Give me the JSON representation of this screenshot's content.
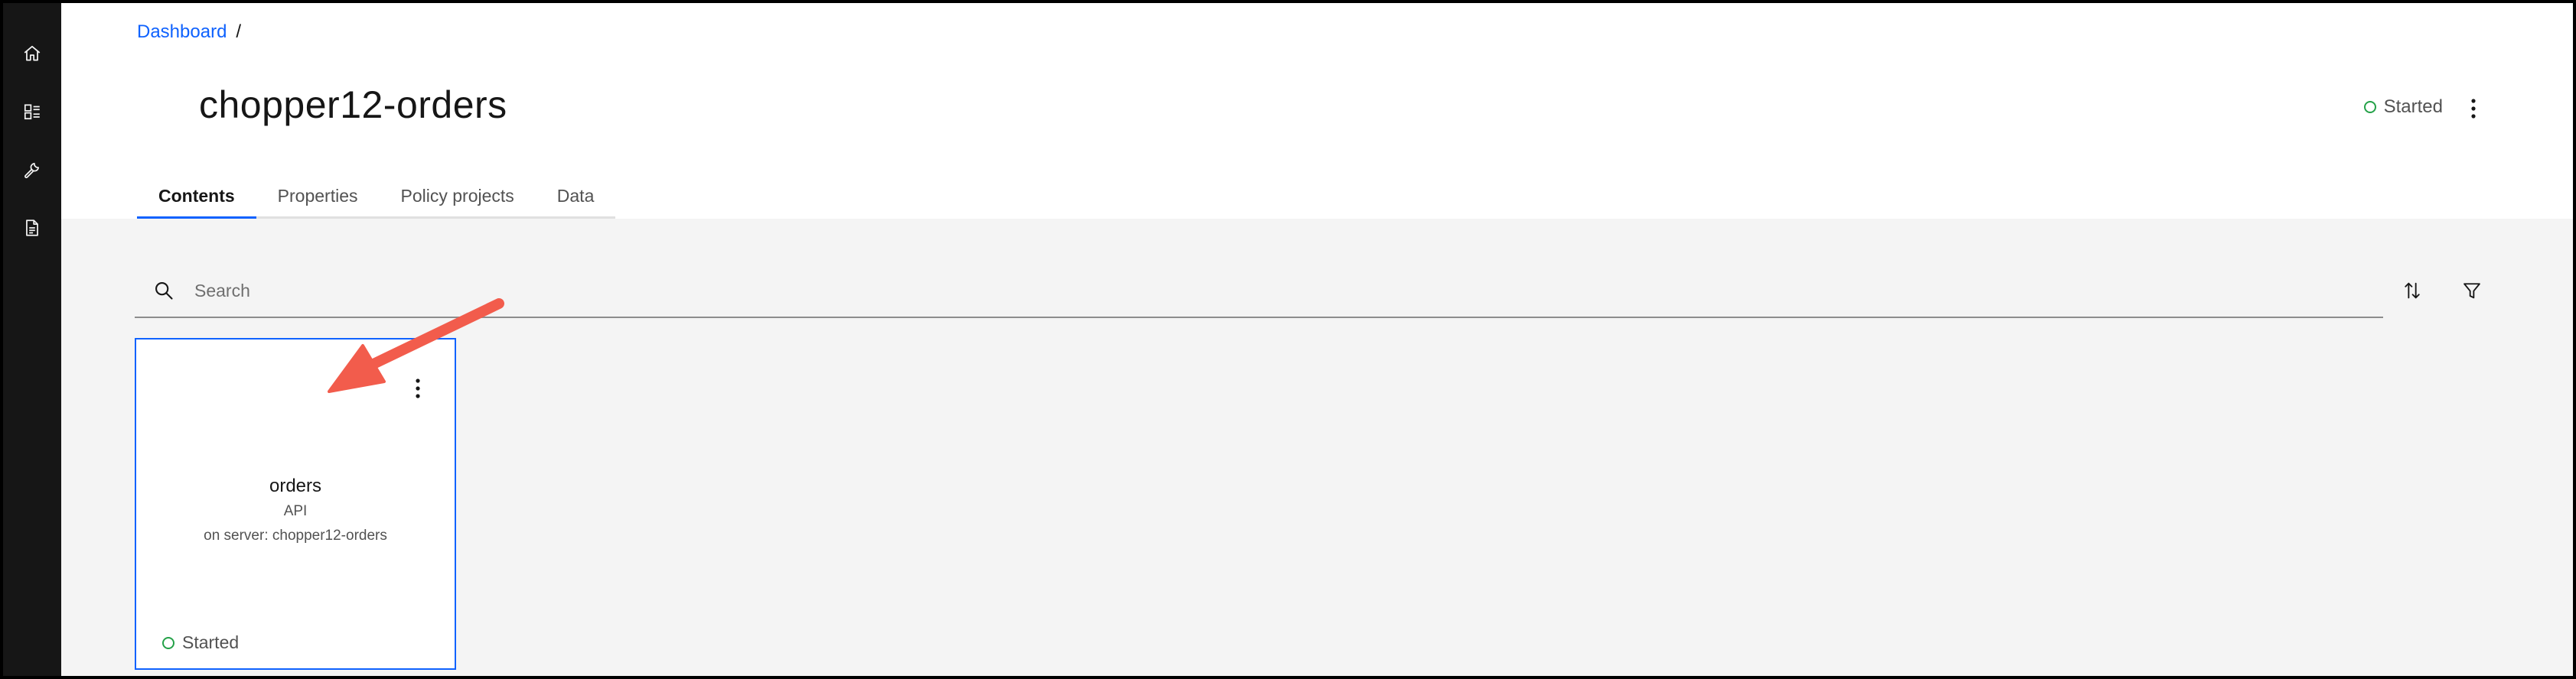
{
  "sidebar": {
    "items": [
      {
        "icon": "home-icon"
      },
      {
        "icon": "dashboard-icon"
      },
      {
        "icon": "wrench-icon"
      },
      {
        "icon": "document-icon"
      }
    ]
  },
  "breadcrumb": {
    "link": "Dashboard",
    "separator": "/"
  },
  "page": {
    "title": "chopper12-orders",
    "status": "Started"
  },
  "tabs": [
    {
      "label": "Contents",
      "active": true
    },
    {
      "label": "Properties",
      "active": false
    },
    {
      "label": "Policy projects",
      "active": false
    },
    {
      "label": "Data",
      "active": false
    }
  ],
  "search": {
    "placeholder": "Search",
    "value": ""
  },
  "cards": [
    {
      "name": "orders",
      "type": "API",
      "server": "on server: chopper12-orders",
      "status": "Started"
    }
  ],
  "colors": {
    "accent": "#0f62fe",
    "status_ok": "#24a148",
    "annotation_arrow": "#f25c4c",
    "sidebar": "#161616"
  }
}
